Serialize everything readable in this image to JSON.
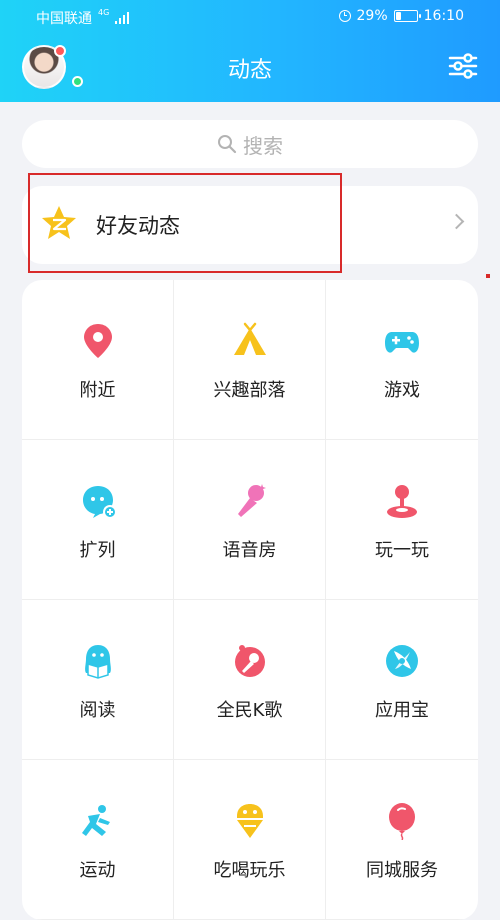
{
  "status_bar": {
    "carrier": "中国联通",
    "network": "4G",
    "battery": "29%",
    "battery_level": 0.29,
    "time": "16:10"
  },
  "header": {
    "title": "动态",
    "avatar_icon": "user-avatar",
    "settings_icon": "sliders-icon",
    "colors": {
      "gradient_start": "#1fd3f7",
      "gradient_end": "#1f9bff"
    }
  },
  "search": {
    "placeholder": "搜索",
    "icon": "search-icon"
  },
  "friends_feed": {
    "label": "好友动态",
    "icon": "qzone-star-icon"
  },
  "grid": {
    "items": [
      {
        "label": "附近",
        "icon": "location-pin-icon",
        "color": "#f0566b"
      },
      {
        "label": "兴趣部落",
        "icon": "tribe-tent-icon",
        "color": "#f7c21c"
      },
      {
        "label": "游戏",
        "icon": "gamepad-icon",
        "color": "#2fc6e8"
      },
      {
        "label": "扩列",
        "icon": "add-friend-chat-icon",
        "color": "#2fc6e8"
      },
      {
        "label": "语音房",
        "icon": "microphone-icon",
        "color": "#f073b8"
      },
      {
        "label": "玩一玩",
        "icon": "joystick-icon",
        "color": "#f0566b"
      },
      {
        "label": "阅读",
        "icon": "reading-penguin-icon",
        "color": "#2fc6e8"
      },
      {
        "label": "全民K歌",
        "icon": "karaoke-icon",
        "color": "#f0566b"
      },
      {
        "label": "应用宝",
        "icon": "app-store-icon",
        "color": "#2fc6e8"
      },
      {
        "label": "运动",
        "icon": "running-icon",
        "color": "#2fc6e8"
      },
      {
        "label": "吃喝玩乐",
        "icon": "ice-cream-icon",
        "color": "#f7c21c"
      },
      {
        "label": "同城服务",
        "icon": "balloon-icon",
        "color": "#f0566b"
      }
    ]
  }
}
